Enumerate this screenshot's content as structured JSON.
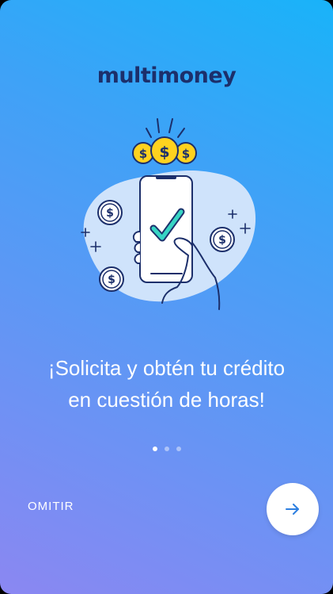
{
  "brand": {
    "logo_text": "multimoney",
    "logo_color": "#1c2f6b"
  },
  "illustration": {
    "icon_name": "phone-approval-coins-illustration"
  },
  "headline": {
    "line1": "¡Solicita y obtén tu crédito",
    "line2": "en cuestión de horas!"
  },
  "pager": {
    "total": 3,
    "active_index": 0
  },
  "actions": {
    "skip_label": "OMITIR",
    "next_icon": "arrow-right-icon"
  },
  "colors": {
    "gradient_top": "#19b3f9",
    "gradient_bottom": "#8b87f2",
    "accent": "#2d7fe0",
    "coin": "#ffd21f"
  }
}
